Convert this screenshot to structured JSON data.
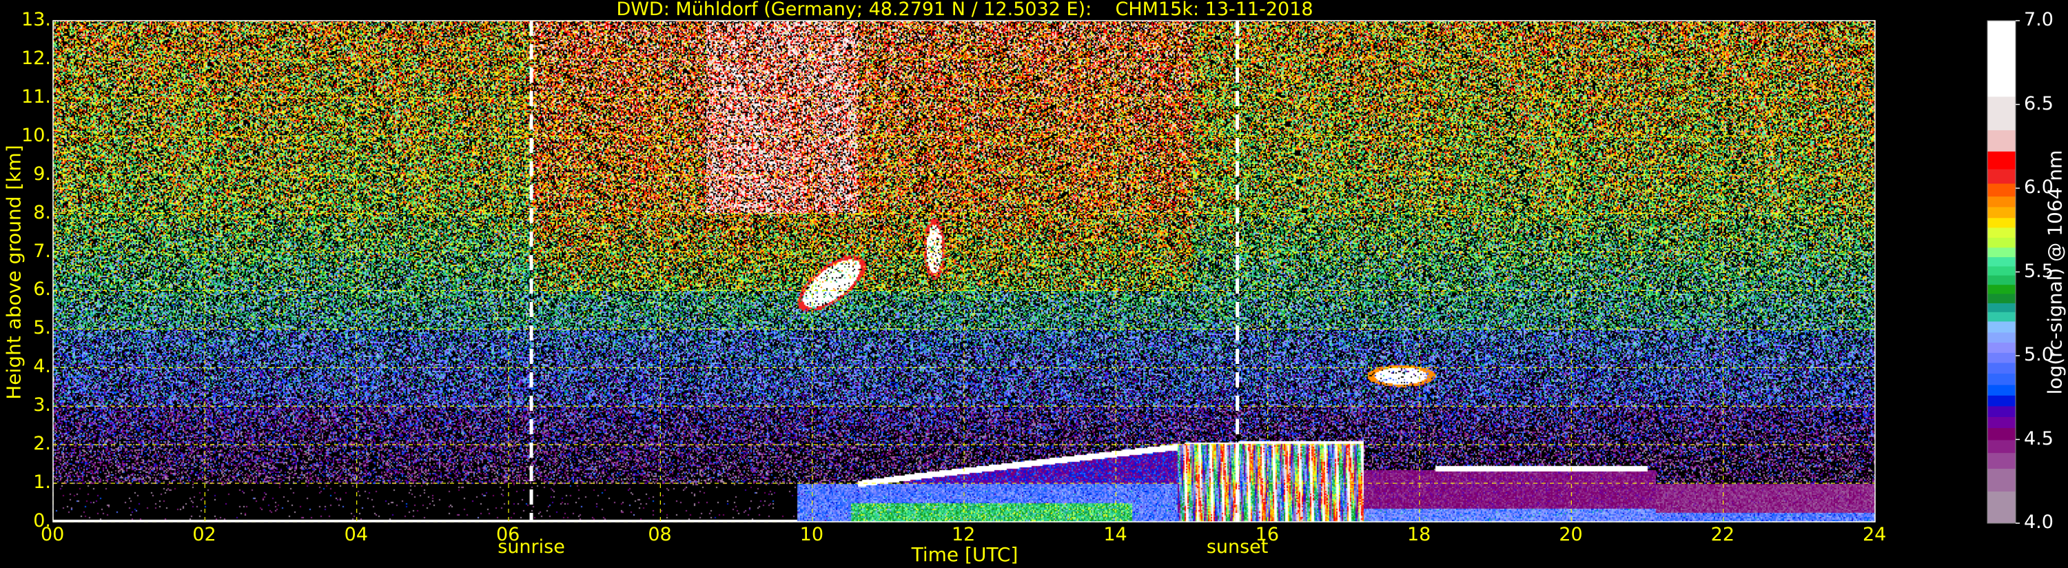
{
  "chart_data": {
    "type": "heatmap",
    "title": "DWD: Mühldorf (Germany; 48.2791 N / 12.5032 E):    CHM15k: 13-11-2018",
    "xlabel": "Time [UTC]",
    "ylabel": "Height above ground [km]",
    "xlim": [
      0,
      24
    ],
    "ylim": [
      0,
      13
    ],
    "xticks": [
      "00",
      "02",
      "04",
      "06",
      "08",
      "10",
      "12",
      "14",
      "16",
      "18",
      "20",
      "22",
      "24"
    ],
    "xtick_values": [
      0,
      2,
      4,
      6,
      8,
      10,
      12,
      14,
      16,
      18,
      20,
      22,
      24
    ],
    "yticks": [
      "0.",
      "1.",
      "2.",
      "3.",
      "4.",
      "5.",
      "6.",
      "7.",
      "8.",
      "9.",
      "10.",
      "11.",
      "12.",
      "13."
    ],
    "ytick_values": [
      0,
      1,
      2,
      3,
      4,
      5,
      6,
      7,
      8,
      9,
      10,
      11,
      12,
      13
    ],
    "grid": true,
    "grid_color": "#ffff00",
    "annotations": [
      {
        "label": "sunrise",
        "time": 6.3
      },
      {
        "label": "sunset",
        "time": 15.6
      }
    ],
    "colorbar": {
      "label": "log(rc-signal) @ 1064 nm",
      "range": [
        4.0,
        7.0
      ],
      "ticks": [
        "4.0",
        "4.5",
        "5.0",
        "5.5",
        "6.0",
        "6.5",
        "7.0"
      ],
      "tick_values": [
        4.0,
        4.5,
        5.0,
        5.5,
        6.0,
        6.5,
        7.0
      ],
      "boundaries": [
        7.0,
        6.546,
        6.346,
        6.219,
        6.113,
        6.027,
        5.95,
        5.887,
        5.822,
        5.764,
        5.704,
        5.645,
        5.588,
        5.533,
        5.479,
        5.423,
        5.369,
        5.313,
        5.26,
        5.204,
        5.138,
        5.078,
        5.017,
        4.957,
        4.893,
        4.825,
        4.762,
        4.698,
        4.634,
        4.568,
        4.496,
        4.419,
        4.325,
        4.189,
        4.0
      ],
      "colors": [
        "#ffffff",
        "#ece4e4",
        "#efc2c2",
        "#ff0000",
        "#f02424",
        "#ff5a00",
        "#ff8c00",
        "#ffb000",
        "#ffe400",
        "#dcff38",
        "#c0ff40",
        "#88ff88",
        "#44e8a0",
        "#30d880",
        "#20c060",
        "#18a818",
        "#149030",
        "#18a090",
        "#30c8a8",
        "#88c0ff",
        "#88a8ff",
        "#8c90ff",
        "#7080ff",
        "#4c70ff",
        "#3068ff",
        "#0058ff",
        "#0018e0",
        "#4a00b8",
        "#7000a0",
        "#800070",
        "#8c2088",
        "#984898",
        "#a070a0",
        "#a890a8"
      ]
    },
    "features": [
      {
        "kind": "cloud",
        "time_range": [
          9.8,
          10.8
        ],
        "height_km": [
          5.4,
          7.5
        ]
      },
      {
        "kind": "cloud",
        "time_range": [
          11.4,
          11.8
        ],
        "height_km": [
          6.2,
          7.9
        ]
      },
      {
        "kind": "cloud",
        "time_range": [
          17.3,
          18.2
        ],
        "height_km": [
          3.4,
          4.2
        ]
      },
      {
        "kind": "boundary-layer-top",
        "time_range": [
          10.6,
          17.2
        ],
        "height_km": [
          1.0,
          2.05
        ]
      },
      {
        "kind": "boundary-layer-top",
        "time_range": [
          18.2,
          21.0
        ],
        "height_km": [
          1.4,
          1.4
        ]
      }
    ]
  }
}
